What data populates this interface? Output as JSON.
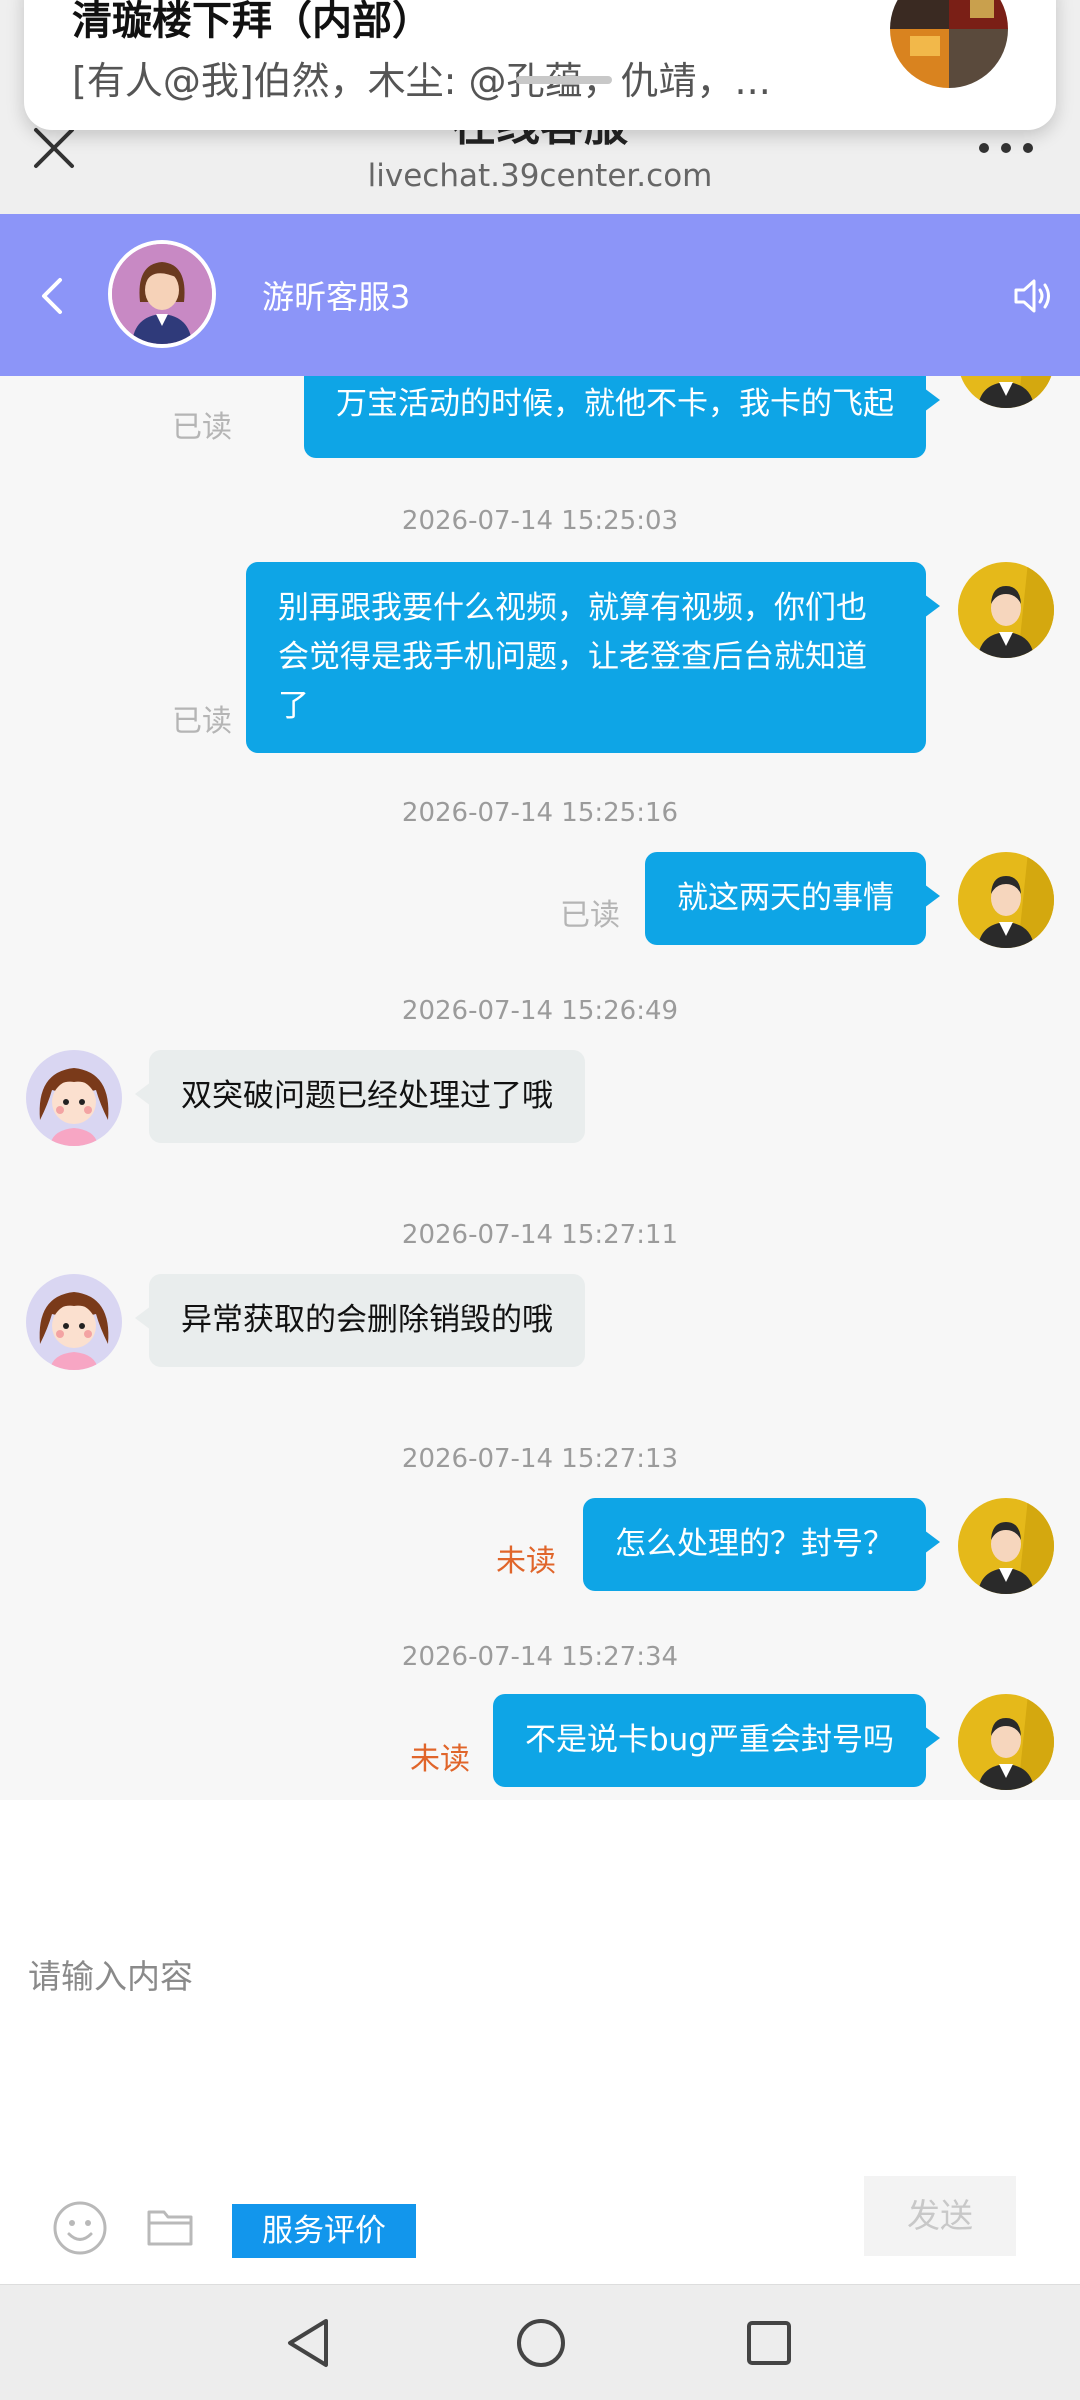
{
  "browser": {
    "page_title_partial": "在线客服",
    "url": "livechat.39center.com"
  },
  "notification": {
    "title": "清璇楼下拜（内部）",
    "body": "[有人@我]伯然，木尘: @孔蕴，仇靖，..."
  },
  "chat_header": {
    "agent_name": "游昕客服3"
  },
  "messages": [
    {
      "from": "user",
      "text": "万宝活动的时候，就他不卡，我卡的飞起",
      "status": "已读"
    },
    {
      "timestamp": "2026-07-14 15:25:03"
    },
    {
      "from": "user",
      "lines": [
        "别再跟我要什么视频，就算有视频，你们也",
        "会觉得是我手机问题，让老登查后台就知道",
        "了"
      ],
      "status": "已读"
    },
    {
      "timestamp": "2026-07-14 15:25:16"
    },
    {
      "from": "user",
      "text": "就这两天的事情",
      "status": "已读"
    },
    {
      "timestamp": "2026-07-14 15:26:49"
    },
    {
      "from": "agent",
      "text": "双突破问题已经处理过了哦"
    },
    {
      "timestamp": "2026-07-14 15:27:11"
    },
    {
      "from": "agent",
      "text": "异常获取的会删除销毁的哦"
    },
    {
      "timestamp": "2026-07-14 15:27:13"
    },
    {
      "from": "user",
      "text": "怎么处理的？封号？",
      "status": "未读"
    },
    {
      "timestamp": "2026-07-14 15:27:34"
    },
    {
      "from": "user",
      "text": "不是说卡bug严重会封号吗",
      "status": "未读"
    }
  ],
  "input": {
    "placeholder": "请输入内容",
    "rate_label": "服务评价",
    "send_label": "发送"
  },
  "colors": {
    "header_bg": "#8c95f8",
    "user_bubble": "#0ea5e6",
    "agent_bubble": "#e9eded",
    "unread": "#e0652a",
    "rate_button": "#1296ec"
  },
  "icons": {
    "close": "close-icon",
    "more": "more-dots-icon",
    "back": "chevron-left-icon",
    "speaker": "speaker-icon",
    "emoji": "smiley-icon",
    "folder": "folder-icon",
    "nav_back": "triangle-back-icon",
    "nav_home": "circle-home-icon",
    "nav_recent": "square-recent-icon"
  }
}
